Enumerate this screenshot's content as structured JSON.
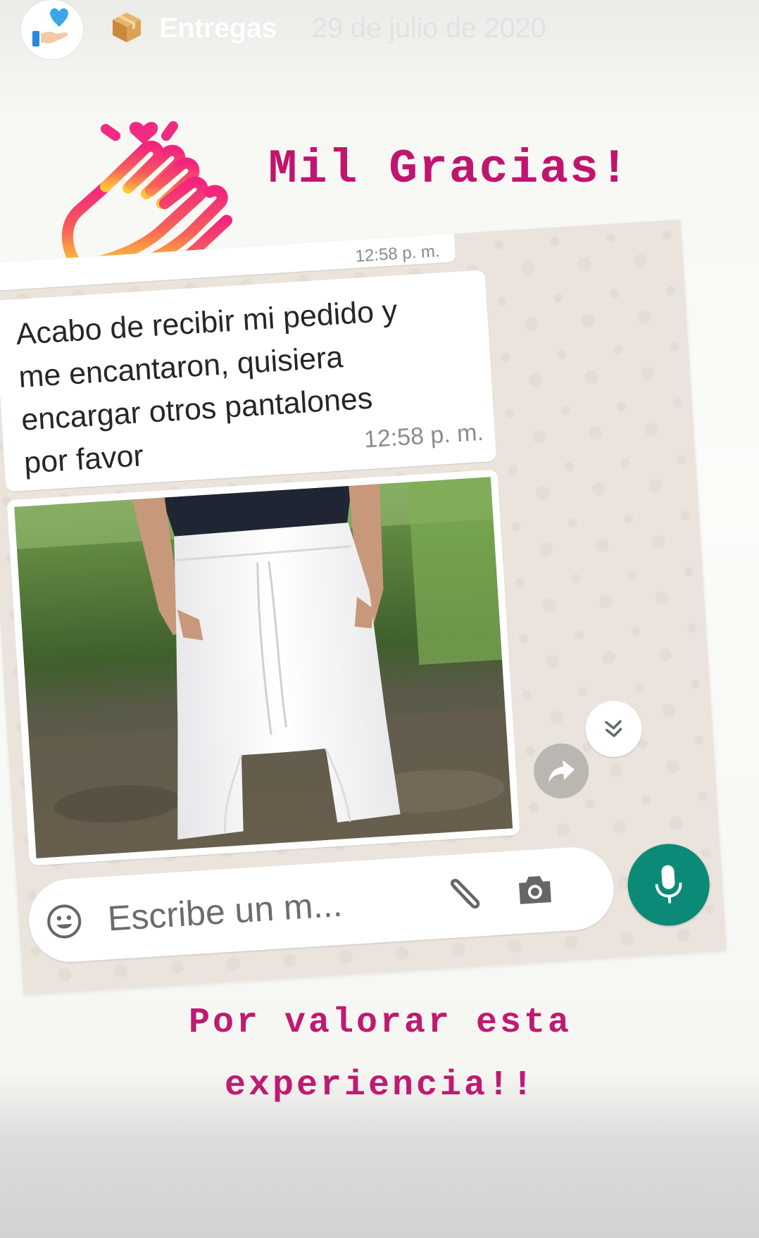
{
  "story": {
    "highlight_title": "Entregas",
    "date": "29 de julio de 2020",
    "avatar_icon": "hand-heart-icon",
    "highlight_emoji": "package-icon"
  },
  "overlay": {
    "title": "Mil Gracias!",
    "caption_line1": "Por valorar esta",
    "caption_line2": "experiencia!!",
    "accent_color": "#c0156f",
    "sticker": "clapping-hands-icon"
  },
  "chat": {
    "previous_message_time": "12:58 p. m.",
    "message": {
      "lines": [
        "Acabo de recibir mi pedido y",
        "me encantaron, quisiera",
        "encargar otros pantalones",
        "por favor"
      ],
      "time": "12:58 p. m."
    },
    "photo_icon": "white-harem-pants-photo",
    "input_placeholder": "Escribe un m...",
    "icons": {
      "emoji": "emoji-icon",
      "attach": "paperclip-icon",
      "camera": "camera-icon",
      "mic": "microphone-icon",
      "forward": "forward-icon",
      "scroll": "double-chevron-down-icon"
    },
    "mic_color": "#0b8a77"
  }
}
